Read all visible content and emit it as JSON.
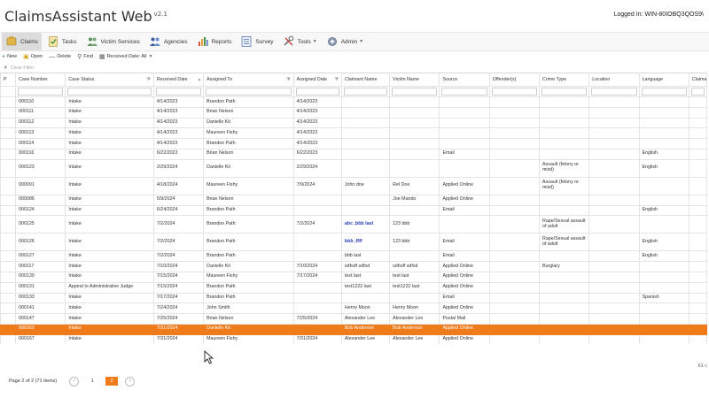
{
  "app": {
    "title": "ClaimsAssistant Web",
    "version": "v2.1",
    "login": "Logged In: WIN-80IOBQ3QOS9\\"
  },
  "menu": [
    {
      "id": "claims",
      "label": "Claims",
      "icon": "claims-icon",
      "active": true,
      "dropdown": false
    },
    {
      "id": "tasks",
      "label": "Tasks",
      "icon": "tasks-icon",
      "active": false,
      "dropdown": false
    },
    {
      "id": "victim-services",
      "label": "Victim Services",
      "icon": "people-icon",
      "active": false,
      "dropdown": false
    },
    {
      "id": "agencies",
      "label": "Agencies",
      "icon": "agencies-icon",
      "active": false,
      "dropdown": false
    },
    {
      "id": "reports",
      "label": "Reports",
      "icon": "bar-chart-icon",
      "active": false,
      "dropdown": false
    },
    {
      "id": "survey",
      "label": "Survey",
      "icon": "survey-icon",
      "active": false,
      "dropdown": false
    },
    {
      "id": "tools",
      "label": "Tools",
      "icon": "tools-icon",
      "active": false,
      "dropdown": true
    },
    {
      "id": "admin",
      "label": "Admin",
      "icon": "gear-icon",
      "active": false,
      "dropdown": true
    }
  ],
  "toolbar": {
    "new": "New",
    "open": "Open",
    "delete": "Delete",
    "find": "Find",
    "received_date": "Received Date: All"
  },
  "filterbar": {
    "clear_filter": "Clear Filter"
  },
  "columns": [
    {
      "key": "flag",
      "label": "P",
      "filter": false
    },
    {
      "key": "case_number",
      "label": "Case Number",
      "filter": false
    },
    {
      "key": "case_status",
      "label": "Case Status",
      "filter": true
    },
    {
      "key": "received_date",
      "label": "Received Date",
      "filter": false,
      "sort": "▴"
    },
    {
      "key": "assigned_to",
      "label": "Assigned To",
      "filter": true
    },
    {
      "key": "assigned_date",
      "label": "Assigned Date",
      "filter": true
    },
    {
      "key": "claimant_name",
      "label": "Claimant Name",
      "filter": false
    },
    {
      "key": "victim_name",
      "label": "Victim Name",
      "filter": false
    },
    {
      "key": "source",
      "label": "Source",
      "filter": false
    },
    {
      "key": "offenders",
      "label": "Offender(s)",
      "filter": false
    },
    {
      "key": "crime_type",
      "label": "Crime Type",
      "filter": false
    },
    {
      "key": "location",
      "label": "Location",
      "filter": false
    },
    {
      "key": "language",
      "label": "Language",
      "filter": false
    },
    {
      "key": "claimant_c",
      "label": "Claimant C",
      "filter": false
    }
  ],
  "rows": [
    {
      "case_number": "000110",
      "case_status": "Intake",
      "received_date": "4/14/2023",
      "assigned_to": "Brandon Path",
      "assigned_date": "4/14/2023",
      "claimant_name": "",
      "victim_name": "",
      "source": "",
      "offenders": "",
      "crime_type": "",
      "location": "",
      "language": "",
      "claimant_c": ""
    },
    {
      "case_number": "000111",
      "case_status": "Intake",
      "received_date": "4/14/2023",
      "assigned_to": "Brian Nelson",
      "assigned_date": "4/14/2023",
      "claimant_name": "",
      "victim_name": "",
      "source": "",
      "offenders": "",
      "crime_type": "",
      "location": "",
      "language": "",
      "claimant_c": ""
    },
    {
      "case_number": "000112",
      "case_status": "Intake",
      "received_date": "4/14/2023",
      "assigned_to": "Danielle Kit",
      "assigned_date": "4/14/2023",
      "claimant_name": "",
      "victim_name": "",
      "source": "",
      "offenders": "",
      "crime_type": "",
      "location": "",
      "language": "",
      "claimant_c": ""
    },
    {
      "case_number": "000113",
      "case_status": "Intake",
      "received_date": "4/14/2023",
      "assigned_to": "Maureen Fishy",
      "assigned_date": "4/14/2023",
      "claimant_name": "",
      "victim_name": "",
      "source": "",
      "offenders": "",
      "crime_type": "",
      "location": "",
      "language": "",
      "claimant_c": ""
    },
    {
      "case_number": "000114",
      "case_status": "Intake",
      "received_date": "4/14/2023",
      "assigned_to": "Brandon Path",
      "assigned_date": "4/14/2023",
      "claimant_name": "",
      "victim_name": "",
      "source": "",
      "offenders": "",
      "crime_type": "",
      "location": "",
      "language": "",
      "claimant_c": ""
    },
    {
      "case_number": "000116",
      "case_status": "Intake",
      "received_date": "6/22/2023",
      "assigned_to": "Brian Nelson",
      "assigned_date": "6/22/2023",
      "claimant_name": "",
      "victim_name": "",
      "source": "Email",
      "offenders": "",
      "crime_type": "",
      "location": "",
      "language": "English",
      "claimant_c": ""
    },
    {
      "case_number": "000123",
      "case_status": "Intake",
      "received_date": "2/29/2024",
      "assigned_to": "Danielle Kit",
      "assigned_date": "2/29/2024",
      "claimant_name": "",
      "victim_name": "",
      "source": "",
      "offenders": "",
      "crime_type": "Assault (felony or misd)",
      "location": "",
      "language": "English",
      "claimant_c": "",
      "tall": true
    },
    {
      "case_number": "000091",
      "case_status": "Intake",
      "received_date": "4/18/2024",
      "assigned_to": "Maureen Fishy",
      "assigned_date": "7/9/2024",
      "claimant_name": "John doe",
      "victim_name": "Rel Doe",
      "source": "Applied Online",
      "offenders": "",
      "crime_type": "Assault (felony or misd)",
      "location": "",
      "language": "",
      "claimant_c": "",
      "tall": true
    },
    {
      "case_number": "000086",
      "case_status": "Intake",
      "received_date": "5/9/2024",
      "assigned_to": "Brian Nelson",
      "assigned_date": "",
      "claimant_name": "",
      "victim_name": "Joe Mando",
      "source": "Applied Online",
      "offenders": "",
      "crime_type": "",
      "location": "",
      "language": "",
      "claimant_c": ""
    },
    {
      "case_number": "000124",
      "case_status": "Intake",
      "received_date": "6/24/2024",
      "assigned_to": "Brandon Path",
      "assigned_date": "",
      "claimant_name": "",
      "victim_name": "",
      "source": "Email",
      "offenders": "",
      "crime_type": "",
      "location": "",
      "language": "English",
      "claimant_c": ""
    },
    {
      "case_number": "000125",
      "case_status": "Intake",
      "received_date": "7/2/2024",
      "assigned_to": "Brandon Path",
      "assigned_date": "7/2/2024",
      "claimant_name": "abc ,bbb last",
      "victim_name": "123 bbb",
      "source": "",
      "offenders": "",
      "crime_type": "Rape/Sexual assault of adult",
      "location": "",
      "language": "",
      "claimant_c": "",
      "tall": true,
      "claimant_bold": true
    },
    {
      "case_number": "000126",
      "case_status": "Intake",
      "received_date": "7/2/2024",
      "assigned_to": "Brandon Path",
      "assigned_date": "",
      "claimant_name": "bbb ,ffff",
      "victim_name": "123 bbb",
      "source": "Email",
      "offenders": "",
      "crime_type": "Rape/Sexual assault of adult",
      "location": "",
      "language": "English",
      "claimant_c": "",
      "tall": true,
      "claimant_bold": true
    },
    {
      "case_number": "000127",
      "case_status": "Intake",
      "received_date": "7/2/2024",
      "assigned_to": "Brandon Path",
      "assigned_date": "",
      "claimant_name": "bbb last",
      "victim_name": "",
      "source": "Email",
      "offenders": "",
      "crime_type": "",
      "location": "",
      "language": "English",
      "claimant_c": ""
    },
    {
      "case_number": "000117",
      "case_status": "Intake",
      "received_date": "7/10/2024",
      "assigned_to": "Danielle Kit",
      "assigned_date": "7/10/2024",
      "claimant_name": "sdfsdf sdfsd",
      "victim_name": "sdfsdf sdfsd",
      "source": "Applied Online",
      "offenders": "",
      "crime_type": "Burglary",
      "location": "",
      "language": "",
      "claimant_c": ""
    },
    {
      "case_number": "000130",
      "case_status": "Intake",
      "received_date": "7/15/2024",
      "assigned_to": "Maureen Fishy",
      "assigned_date": "7/17/2024",
      "claimant_name": "test last",
      "victim_name": "test last",
      "source": "Applied Online",
      "offenders": "",
      "crime_type": "",
      "location": "",
      "language": "",
      "claimant_c": ""
    },
    {
      "case_number": "000131",
      "case_status": "Appeal to Administrative Judge",
      "received_date": "7/15/2024",
      "assigned_to": "Brandon Path",
      "assigned_date": "",
      "claimant_name": "test1222 last",
      "victim_name": "test1222 last",
      "source": "Applied Online",
      "offenders": "",
      "crime_type": "",
      "location": "",
      "language": "",
      "claimant_c": ""
    },
    {
      "case_number": "000133",
      "case_status": "Intake",
      "received_date": "7/17/2024",
      "assigned_to": "Brandon Path",
      "assigned_date": "",
      "claimant_name": "",
      "victim_name": "",
      "source": "Email",
      "offenders": "",
      "crime_type": "",
      "location": "",
      "language": "Spanish",
      "claimant_c": ""
    },
    {
      "case_number": "000141",
      "case_status": "Intake",
      "received_date": "7/24/2024",
      "assigned_to": "John Smith",
      "assigned_date": "",
      "claimant_name": "Henry Moon",
      "victim_name": "Henry Moon",
      "source": "Applied Online",
      "offenders": "",
      "crime_type": "",
      "location": "",
      "language": "",
      "claimant_c": ""
    },
    {
      "case_number": "000147",
      "case_status": "Intake",
      "received_date": "7/25/2024",
      "assigned_to": "Brian Nelson",
      "assigned_date": "7/25/2024",
      "claimant_name": "Alexander Lee",
      "victim_name": "Alexander Lee",
      "source": "Postal Mail",
      "offenders": "",
      "crime_type": "",
      "location": "",
      "language": "",
      "claimant_c": ""
    },
    {
      "case_number": "000163",
      "case_status": "Intake",
      "received_date": "7/31/2024",
      "assigned_to": "Danielle Kit",
      "assigned_date": "",
      "claimant_name": "Bob Anderson",
      "victim_name": "Bob Anderson",
      "source": "Applied Online",
      "offenders": "",
      "crime_type": "",
      "location": "",
      "language": "",
      "claimant_c": "",
      "selected": true
    },
    {
      "case_number": "000167",
      "case_status": "Intake",
      "received_date": "7/31/2024",
      "assigned_to": "Maureen Fishy",
      "assigned_date": "7/31/2024",
      "claimant_name": "Alexander Lee",
      "victim_name": "Alexander Lee",
      "source": "Applied Online",
      "offenders": "",
      "crime_type": "",
      "location": "",
      "language": "",
      "claimant_c": ""
    }
  ],
  "pager": {
    "summary": "Page 2 of 2 (71 items)",
    "pages": [
      "1",
      "2"
    ],
    "current": "2",
    "total_right": "61 c"
  },
  "colors": {
    "accent": "#ef7b1a",
    "link": "#2a3fb8"
  }
}
